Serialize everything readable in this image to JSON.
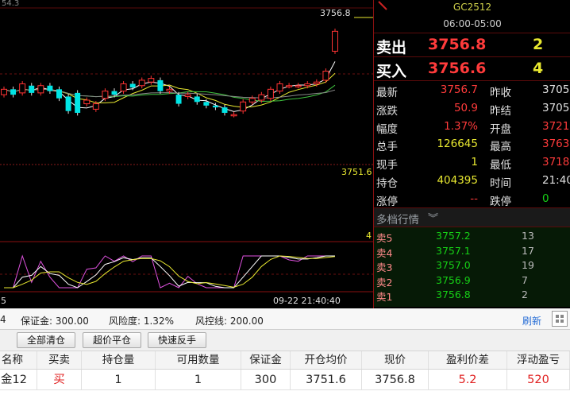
{
  "chart": {
    "top_left_partial": "54.3",
    "last_price_tag": "3756.8",
    "avg_price_tag": "3751.6",
    "volume_scale": "4",
    "x_left": "5",
    "x_time": "09-22 21:40:40",
    "colors": {
      "up": "#ff3333",
      "down": "#00e5e5",
      "ma_white": "#ffffff",
      "ma_yellow": "#e8e830",
      "ma_green": "#3fc43f",
      "ma_grey": "#8a8a8a",
      "ind_pink": "#e052e0",
      "ind_white": "#ffffff",
      "ind_yellow": "#e8e830"
    }
  },
  "chart_data": {
    "type": "candlestick",
    "title": "",
    "ylim": [
      3748,
      3758
    ],
    "candles": [
      {
        "o": 3753.3,
        "c": 3753.6
      },
      {
        "o": 3753.6,
        "c": 3753.3
      },
      {
        "o": 3753.4,
        "c": 3753.9
      },
      {
        "o": 3753.8,
        "c": 3753.4
      },
      {
        "o": 3753.4,
        "c": 3753.8
      },
      {
        "o": 3753.8,
        "c": 3753.5
      },
      {
        "o": 3753.6,
        "c": 3753.1
      },
      {
        "o": 3753.2,
        "c": 3752.4
      },
      {
        "o": 3753.4,
        "c": 3752.3
      },
      {
        "o": 3752.8,
        "c": 3753.0
      },
      {
        "o": 3752.5,
        "c": 3752.8
      },
      {
        "o": 3753.1,
        "c": 3753.5
      },
      {
        "o": 3753.5,
        "c": 3753.3
      },
      {
        "o": 3753.5,
        "c": 3753.9
      },
      {
        "o": 3753.9,
        "c": 3753.7
      },
      {
        "o": 3753.8,
        "c": 3754.1
      },
      {
        "o": 3754.0,
        "c": 3754.2
      },
      {
        "o": 3754.1,
        "c": 3753.5
      },
      {
        "o": 3753.5,
        "c": 3753.6
      },
      {
        "o": 3753.3,
        "c": 3752.8
      },
      {
        "o": 3753.2,
        "c": 3753.3
      },
      {
        "o": 3753.2,
        "c": 3752.9
      },
      {
        "o": 3752.9,
        "c": 3752.7
      },
      {
        "o": 3752.7,
        "c": 3752.6
      },
      {
        "o": 3752.6,
        "c": 3752.3
      },
      {
        "o": 3752.2,
        "c": 3752.2
      },
      {
        "o": 3752.4,
        "c": 3752.9
      },
      {
        "o": 3752.9,
        "c": 3753.1
      },
      {
        "o": 3753.0,
        "c": 3753.3
      },
      {
        "o": 3753.1,
        "c": 3753.6
      },
      {
        "o": 3753.5,
        "c": 3753.9
      },
      {
        "o": 3753.8,
        "c": 3753.8
      },
      {
        "o": 3753.8,
        "c": 3753.8
      },
      {
        "o": 3753.8,
        "c": 3753.9
      },
      {
        "o": 3753.9,
        "c": 3754.0
      },
      {
        "o": 3754.1,
        "c": 3754.6
      },
      {
        "o": 3755.7,
        "c": 3756.8
      }
    ]
  },
  "quote": {
    "symbol": "GC2512",
    "session": "06:00-05:00",
    "sell_label": "卖出",
    "sell_price": "3756.8",
    "sell_vol": "2",
    "buy_label": "买入",
    "buy_price": "3756.6",
    "buy_vol": "4",
    "stats": [
      {
        "k1": "最新",
        "v1": "3756.7",
        "c1": "red",
        "k2": "昨收",
        "v2": "3705",
        "c2": "wht"
      },
      {
        "k1": "涨跌",
        "v1": "50.9",
        "c1": "red",
        "k2": "昨结",
        "v2": "3705",
        "c2": "wht"
      },
      {
        "k1": "幅度",
        "v1": "1.37%",
        "c1": "red",
        "k2": "开盘",
        "v2": "3721",
        "c2": "red"
      },
      {
        "k1": "总手",
        "v1": "126645",
        "c1": "yel",
        "k2": "最高",
        "v2": "3763",
        "c2": "red"
      },
      {
        "k1": "现手",
        "v1": "1",
        "c1": "yel",
        "k2": "最低",
        "v2": "3718",
        "c2": "red"
      },
      {
        "k1": "持仓",
        "v1": "404395",
        "c1": "yel",
        "k2": "时间",
        "v2": "21:40:5",
        "c2": "wht"
      },
      {
        "k1": "涨停",
        "v1": "--",
        "c1": "red",
        "k2": "跌停",
        "v2": "0",
        "c2": "grn"
      }
    ],
    "depth_title": "多档行情",
    "depth_chevron": "︾",
    "depth": [
      {
        "k": "卖5",
        "p": "3757.2",
        "v": "13"
      },
      {
        "k": "卖4",
        "p": "3757.1",
        "v": "17"
      },
      {
        "k": "卖3",
        "p": "3757.0",
        "v": "19"
      },
      {
        "k": "卖2",
        "p": "3756.9",
        "v": "7"
      },
      {
        "k": "卖1",
        "p": "3756.8",
        "v": "2"
      }
    ]
  },
  "account": {
    "lead": "4",
    "margin": "保证金: 300.00",
    "risk": "风险度: 1.32%",
    "control": "风控线: 200.00",
    "refresh": "刷新"
  },
  "buttons": {
    "close_all": "全部清仓",
    "flat_over": "超价平仓",
    "reverse": "快速反手"
  },
  "table": {
    "headers": [
      "名称",
      "买卖",
      "持仓量",
      "可用数量",
      "保证金",
      "开仓均价",
      "现价",
      "盈利价差",
      "浮动盈亏"
    ],
    "row": [
      "金12",
      "买",
      "1",
      "1",
      "300",
      "3751.6",
      "3756.8",
      "5.2",
      "520"
    ]
  }
}
